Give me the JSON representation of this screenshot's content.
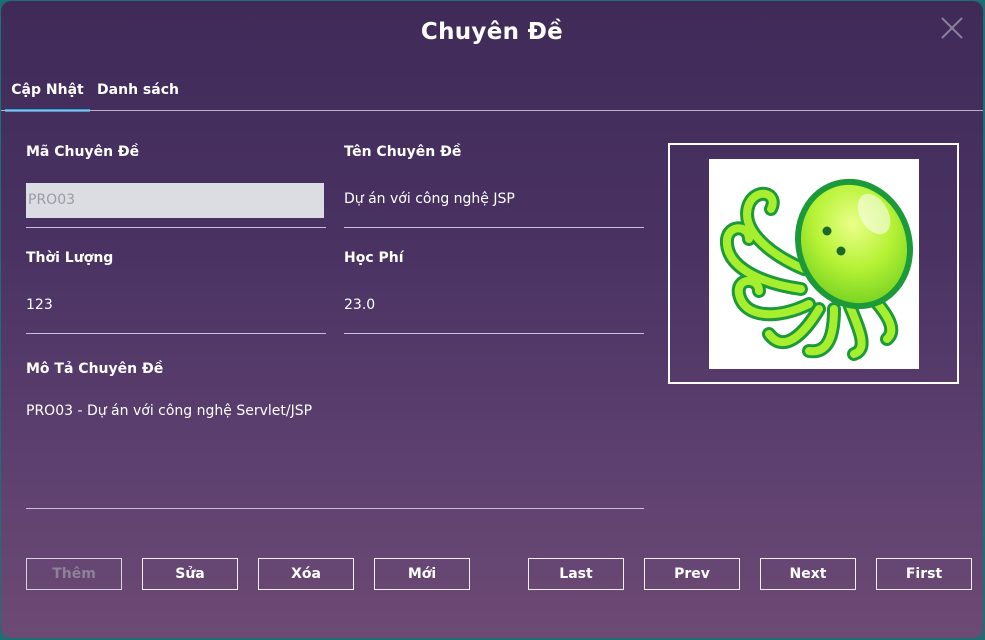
{
  "window": {
    "title": "Chuyên Đề"
  },
  "tabs": [
    {
      "label": "Cập Nhật",
      "active": true
    },
    {
      "label": "Danh sách",
      "active": false
    }
  ],
  "form": {
    "ma_chuyen_de": {
      "label": "Mã Chuyên Đề",
      "value": "PRO03",
      "disabled": true
    },
    "ten_chuyen_de": {
      "label": "Tên Chuyên Đề",
      "value": "Dự án với công nghệ JSP"
    },
    "thoi_luong": {
      "label": "Thời Lượng",
      "value": "123"
    },
    "hoc_phi": {
      "label": "Học Phí",
      "value": "23.0"
    },
    "mo_ta": {
      "label": "Mô Tả Chuyên Đề",
      "value": "PRO03 - Dự án với công nghệ Servlet/JSP"
    }
  },
  "image": {
    "icon": "octopus-logo",
    "colors": {
      "body": "#a6ee2e",
      "outline": "#1c9a3a"
    }
  },
  "buttons": {
    "them": "Thêm",
    "sua": "Sửa",
    "xoa": "Xóa",
    "moi": "Mới",
    "last": "Last",
    "prev": "Prev",
    "next": "Next",
    "first": "First"
  },
  "colors": {
    "accent": "#2aa3e0",
    "bg_top": "#3f2a58",
    "bg_bottom": "#6c4a74"
  }
}
